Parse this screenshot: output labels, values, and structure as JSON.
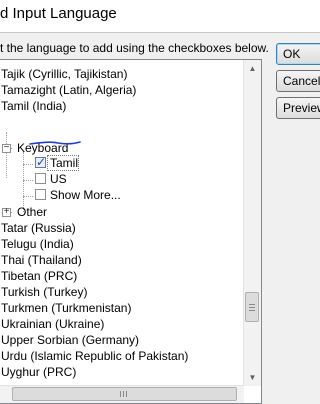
{
  "window": {
    "title": "d Input Language"
  },
  "instruction": "t the language to add using the checkboxes below.",
  "buttons": {
    "ok": "OK",
    "cancel": "Cancel",
    "preview": "Preview"
  },
  "tree": {
    "rows": [
      {
        "label": "Tajik (Cyrillic, Tajikistan)"
      },
      {
        "label": "Tamazight (Latin, Algeria)"
      },
      {
        "label": "Tamil (India)"
      },
      {
        "label": "Keyboard",
        "expander": "−"
      },
      {
        "label": "Tamil",
        "checked": true
      },
      {
        "label": "US",
        "checked": false
      },
      {
        "label": "Show More...",
        "checked": false
      },
      {
        "label": "Other",
        "expander": "+"
      },
      {
        "label": "Tatar (Russia)"
      },
      {
        "label": "Telugu (India)"
      },
      {
        "label": "Thai (Thailand)"
      },
      {
        "label": "Tibetan (PRC)"
      },
      {
        "label": "Turkish (Turkey)"
      },
      {
        "label": "Turkmen (Turkmenistan)"
      },
      {
        "label": "Ukrainian (Ukraine)"
      },
      {
        "label": "Upper Sorbian (Germany)"
      },
      {
        "label": "Urdu (Islamic Republic of Pakistan)"
      },
      {
        "label": "Uyghur (PRC)"
      }
    ]
  },
  "icons": {
    "scroll_up": "scroll-up-arrow-icon",
    "scroll_down": "scroll-down-arrow-icon",
    "annotation": "blue-pen-underline"
  },
  "colors": {
    "annotation": "#1f3fc4"
  }
}
